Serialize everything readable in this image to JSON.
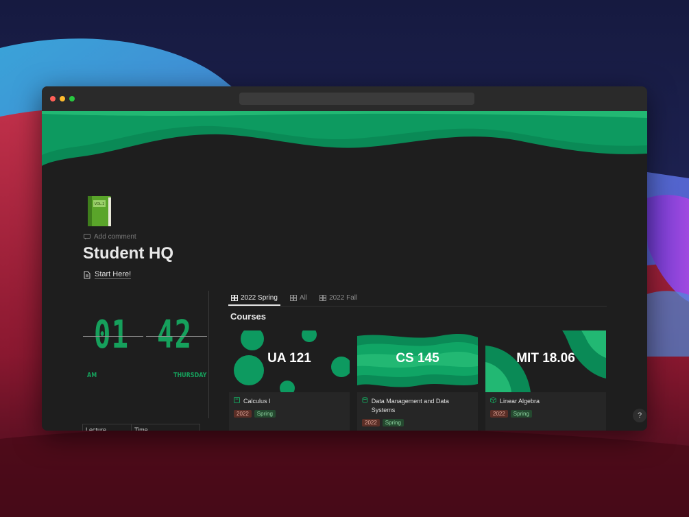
{
  "page": {
    "title": "Student HQ",
    "add_comment": "Add comment",
    "start_link": "Start Here!",
    "icon": "green-book-icon"
  },
  "clock": {
    "hour": "01",
    "minute": "42",
    "period": "AM",
    "day": "THURSDAY",
    "color": "#16a05c"
  },
  "mini_table": {
    "headers": [
      "Lecture",
      "Time"
    ]
  },
  "tabs": [
    {
      "label": "2022 Spring",
      "active": true
    },
    {
      "label": "All",
      "active": false
    },
    {
      "label": "2022 Fall",
      "active": false
    }
  ],
  "courses_section": {
    "title": "Courses",
    "cards": [
      {
        "cover_text": "UA 121",
        "name": "Calculus I",
        "tags": [
          "2022",
          "Spring"
        ]
      },
      {
        "cover_text": "CS 145",
        "name": "Data Management and Data Systems",
        "tags": [
          "2022",
          "Spring"
        ]
      },
      {
        "cover_text": "MIT 18.06",
        "name": "Linear Algebra",
        "tags": [
          "2022",
          "Spring"
        ]
      }
    ]
  },
  "help": "?",
  "colors": {
    "accent_green": "#16a05c",
    "cover_green": "#0b9b62",
    "window_bg": "#1e1e1e"
  }
}
